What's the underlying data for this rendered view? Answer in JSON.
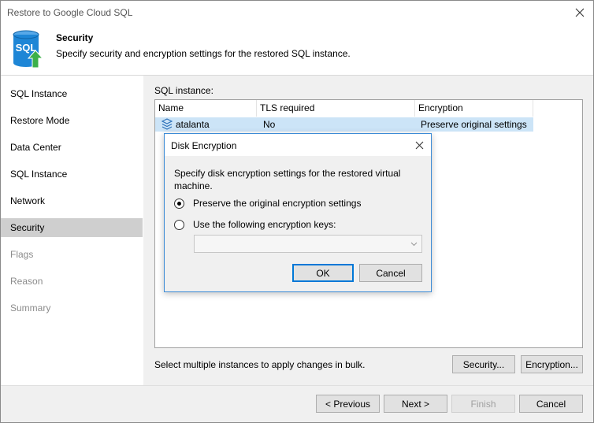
{
  "window": {
    "title": "Restore to Google Cloud SQL"
  },
  "header": {
    "title": "Security",
    "subtitle": "Specify security and encryption settings for the restored SQL instance.",
    "logo_text": "SQL"
  },
  "sidebar": {
    "items": [
      {
        "label": "SQL Instance",
        "state": "normal"
      },
      {
        "label": "Restore Mode",
        "state": "normal"
      },
      {
        "label": "Data Center",
        "state": "normal"
      },
      {
        "label": "SQL Instance",
        "state": "normal"
      },
      {
        "label": "Network",
        "state": "normal"
      },
      {
        "label": "Security",
        "state": "active"
      },
      {
        "label": "Flags",
        "state": "disabled"
      },
      {
        "label": "Reason",
        "state": "disabled"
      },
      {
        "label": "Summary",
        "state": "disabled"
      }
    ]
  },
  "main": {
    "sql_instance_label": "SQL instance:",
    "columns": [
      "Name",
      "TLS required",
      "Encryption"
    ],
    "rows": [
      {
        "name": "atalanta",
        "tls": "No",
        "encryption": "Preserve original settings"
      }
    ],
    "bulk_note": "Select multiple instances to apply changes in bulk.",
    "security_button": "Security...",
    "encryption_button": "Encryption..."
  },
  "dialog": {
    "title": "Disk Encryption",
    "description": "Specify disk encryption settings for the restored virtual machine.",
    "option_preserve": "Preserve the original encryption settings",
    "option_keys": "Use the following encryption keys:",
    "selected_option": "preserve",
    "keys_value": "",
    "ok_label": "OK",
    "cancel_label": "Cancel"
  },
  "footer": {
    "previous_label": "< Previous",
    "next_label": "Next >",
    "finish_label": "Finish",
    "cancel_label": "Cancel"
  },
  "colors": {
    "accent": "#0078d7",
    "selection": "#cce4f7",
    "active_nav": "#cfcfcf",
    "logo_blue": "#1e86d6",
    "logo_arrow": "#3cb04a"
  }
}
